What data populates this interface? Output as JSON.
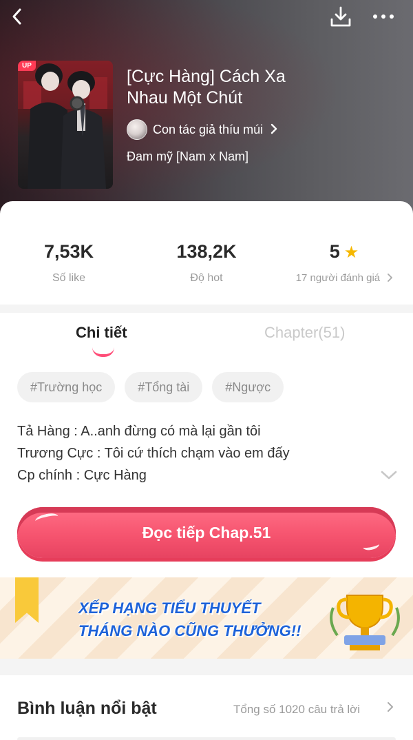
{
  "header": {
    "cover_badge": "UP",
    "title": "[Cực Hàng] Cách Xa Nhau Một Chút",
    "author": "Con tác giả thíu múi",
    "genre": "Đam mỹ [Nam x Nam]"
  },
  "stats": {
    "likes": {
      "value": "7,53K",
      "label": "Số like"
    },
    "hot": {
      "value": "138,2K",
      "label": "Độ hot"
    },
    "rating": {
      "value": "5",
      "label": "17 người đánh giá"
    }
  },
  "tabs": {
    "details": "Chi tiết",
    "chapters": "Chapter(51)"
  },
  "tags": [
    "#Trường học",
    "#Tổng tài",
    "#Ngược"
  ],
  "description": [
    "Tả Hàng : A..anh đừng có mà lại gần tôi",
    "Trương Cực : Tôi cứ thích chạm vào em đấy",
    "Cp chính : Cực Hàng"
  ],
  "read_button": "Đọc tiếp Chap.51",
  "banner": {
    "line1": "XẾP HẠNG TIỂU THUYẾT",
    "line2": "THÁNG NÀO CŨNG THƯỞNG!!"
  },
  "comments": {
    "title": "Bình luận nổi bật",
    "total": "Tổng số 1020 câu trả lời"
  },
  "colors": {
    "accent": "#f6546f",
    "star": "#f6b800",
    "banner_text": "#1d62d8"
  }
}
